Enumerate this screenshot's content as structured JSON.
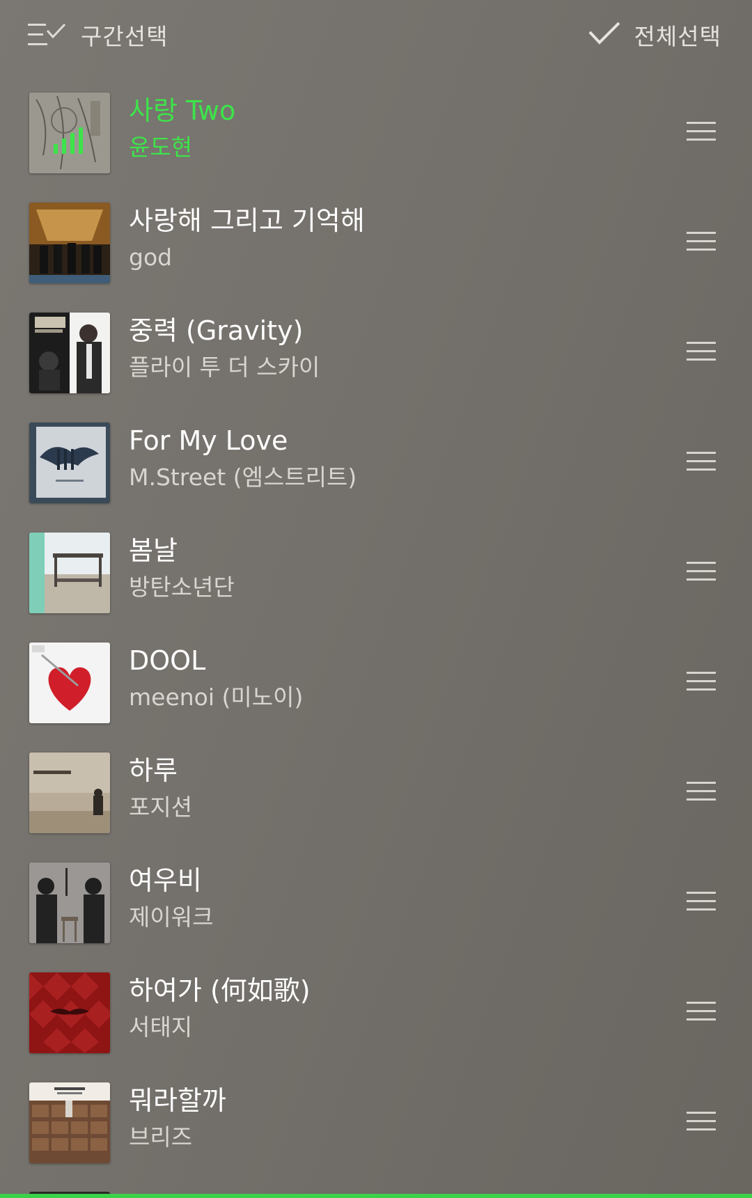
{
  "header": {
    "range_select_label": "구간선택",
    "select_all_label": "전체선택"
  },
  "colors": {
    "playing": "#3de34a",
    "accent_bar": "#3bd24a",
    "background": "#75716c"
  },
  "tracks": [
    {
      "title": "사랑 Two",
      "artist": "윤도현",
      "playing": true,
      "art": "yoon-do-hyun-album-art"
    },
    {
      "title": "사랑해 그리고 기억해",
      "artist": "god",
      "playing": false,
      "art": "god-album-art"
    },
    {
      "title": "중력 (Gravity)",
      "artist": "플라이 투 더 스카이",
      "playing": false,
      "art": "gravity-album-art"
    },
    {
      "title": "For My Love",
      "artist": "M.Street (엠스트리트)",
      "playing": false,
      "art": "mstreet-album-art"
    },
    {
      "title": "봄날",
      "artist": "방탄소년단",
      "playing": false,
      "art": "bts-spring-day-album-art"
    },
    {
      "title": "DOOL",
      "artist": "meenoi (미노이)",
      "playing": false,
      "art": "meenoi-album-art"
    },
    {
      "title": "하루",
      "artist": "포지션",
      "playing": false,
      "art": "position-album-art"
    },
    {
      "title": "여우비",
      "artist": "제이워크",
      "playing": false,
      "art": "jwalk-album-art"
    },
    {
      "title": "하여가 (何如歌)",
      "artist": "서태지",
      "playing": false,
      "art": "seo-taiji-album-art"
    },
    {
      "title": "뭐라할까",
      "artist": "브리즈",
      "playing": false,
      "art": "the-breeze-album-art"
    }
  ]
}
